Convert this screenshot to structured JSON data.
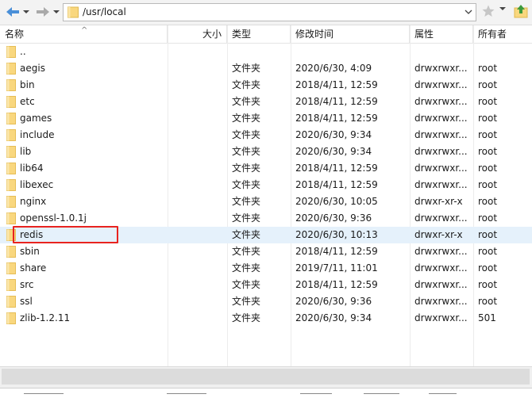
{
  "path": {
    "value": "/usr/local"
  },
  "columns": {
    "name": "名称",
    "size": "大小",
    "type": "类型",
    "modified": "修改时间",
    "permissions": "属性",
    "owner": "所有者"
  },
  "files": [
    {
      "name": "..",
      "type": "",
      "modified": "",
      "permissions": "",
      "owner": ""
    },
    {
      "name": "aegis",
      "type": "文件夹",
      "modified": "2020/6/30, 4:09",
      "permissions": "drwxrwxr...",
      "owner": "root"
    },
    {
      "name": "bin",
      "type": "文件夹",
      "modified": "2018/4/11, 12:59",
      "permissions": "drwxrwxr...",
      "owner": "root"
    },
    {
      "name": "etc",
      "type": "文件夹",
      "modified": "2018/4/11, 12:59",
      "permissions": "drwxrwxr...",
      "owner": "root"
    },
    {
      "name": "games",
      "type": "文件夹",
      "modified": "2018/4/11, 12:59",
      "permissions": "drwxrwxr...",
      "owner": "root"
    },
    {
      "name": "include",
      "type": "文件夹",
      "modified": "2020/6/30, 9:34",
      "permissions": "drwxrwxr...",
      "owner": "root"
    },
    {
      "name": "lib",
      "type": "文件夹",
      "modified": "2020/6/30, 9:34",
      "permissions": "drwxrwxr...",
      "owner": "root"
    },
    {
      "name": "lib64",
      "type": "文件夹",
      "modified": "2018/4/11, 12:59",
      "permissions": "drwxrwxr...",
      "owner": "root"
    },
    {
      "name": "libexec",
      "type": "文件夹",
      "modified": "2018/4/11, 12:59",
      "permissions": "drwxrwxr...",
      "owner": "root"
    },
    {
      "name": "nginx",
      "type": "文件夹",
      "modified": "2020/6/30, 10:05",
      "permissions": "drwxr-xr-x",
      "owner": "root"
    },
    {
      "name": "openssl-1.0.1j",
      "type": "文件夹",
      "modified": "2020/6/30, 9:36",
      "permissions": "drwxrwxr...",
      "owner": "root"
    },
    {
      "name": "redis",
      "type": "文件夹",
      "modified": "2020/6/30, 10:13",
      "permissions": "drwxr-xr-x",
      "owner": "root"
    },
    {
      "name": "sbin",
      "type": "文件夹",
      "modified": "2018/4/11, 12:59",
      "permissions": "drwxrwxr...",
      "owner": "root"
    },
    {
      "name": "share",
      "type": "文件夹",
      "modified": "2019/7/11, 11:01",
      "permissions": "drwxrwxr...",
      "owner": "root"
    },
    {
      "name": "src",
      "type": "文件夹",
      "modified": "2018/4/11, 12:59",
      "permissions": "drwxrwxr...",
      "owner": "root"
    },
    {
      "name": "ssl",
      "type": "文件夹",
      "modified": "2020/6/30, 9:36",
      "permissions": "drwxrwxr...",
      "owner": "root"
    },
    {
      "name": "zlib-1.2.11",
      "type": "文件夹",
      "modified": "2020/6/30, 9:34",
      "permissions": "drwxrwxr...",
      "owner": "501"
    }
  ],
  "selected_file": "redis",
  "colors": {
    "folder": "#f9d77e",
    "selection": "#e5f1fb",
    "highlight": "#e8231f",
    "nav_arrow": "#4a8fd8"
  },
  "icons": {
    "back": "arrow-left-icon",
    "forward": "arrow-right-icon",
    "folder": "folder-icon",
    "bookmark": "star-icon",
    "up": "folder-up-icon"
  }
}
